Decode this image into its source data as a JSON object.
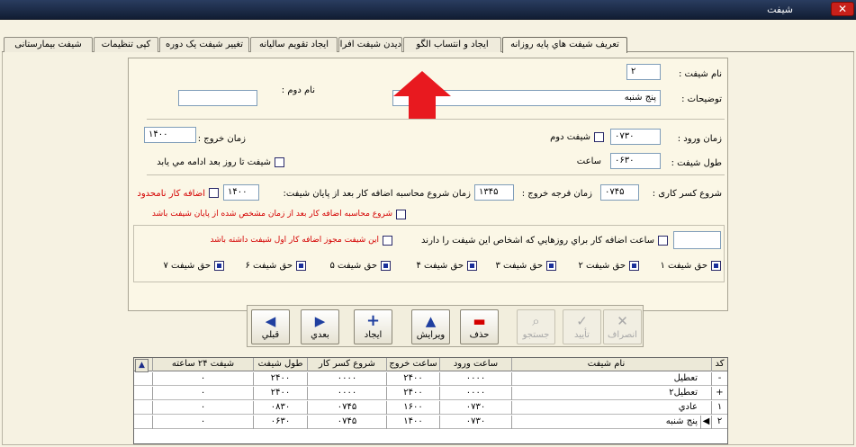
{
  "window": {
    "title": "شيفت",
    "close": "✕"
  },
  "tabs": [
    "تعريف شيفت هاي پايه روزانه",
    "ايجاد و انتساب الگو",
    "ديدن شيفت افراد",
    "ايجاد تقويم ساليانه",
    "تغيير شيفت يک دوره",
    "کپی تنظيمات",
    "شيفت بيمارستانی"
  ],
  "form": {
    "shift_name_label": "نام شيفت :",
    "shift_name": "٢",
    "second_name_label": "نام دوم :",
    "second_name": "",
    "desc_label": "توضيحات :",
    "desc": "پنج شنبه",
    "entry_label": "زمان ورود :",
    "entry": "٠٧٣٠",
    "second_shift_label": "شيفت دوم",
    "exit_label": "زمان خروج :",
    "exit": "١۴٠٠",
    "length_label": "طول شيفت :",
    "length": "٠۶٣٠",
    "hours_label": "ساعت",
    "next_day_label": "شيفت تا روز بعد ادامه مي يابد",
    "deduct_label": "شروع کسر کاری :",
    "deduct": "٠٧۴۵",
    "grace_label": "زمان فرجه خروج :",
    "grace": "١٣۴۵",
    "ot_start_label": "زمان شروع محاسبه اضافه کار بعد از پايان شيفت:",
    "ot_start": "١۴٠٠",
    "unlimited_label": "اضافه کار نامحدود",
    "ot_after_label": "شروع محاسبه اضافه کار بعد از زمان مشخص شده از پايان شيفت باشد",
    "holiday_ot_label": "ساعت اضافه کار براي روزهايي که اشخاص اين شيفت را دارند",
    "holiday_ot": "",
    "first_shift_ot_label": "اين شيفت مجوز اضافه کار اول شيفت داشته باشد",
    "rights": [
      "حق شيفت ١",
      "حق شيفت ٢",
      "حق شيفت ٣",
      "حق شيفت ۴",
      "حق شيفت ۵",
      "حق شيفت ۶",
      "حق شيفت ٧"
    ]
  },
  "toolbar": {
    "cancel": "انصراف",
    "confirm": "تأييد",
    "search": "جستجو",
    "delete": "حذف",
    "edit": "ويرايش",
    "add": "ايجاد",
    "next": "بعدي",
    "prev": "قبلي"
  },
  "grid": {
    "headers": [
      "کد",
      "نام شيفت",
      "ساعت ورود",
      "ساعت خروج",
      "شروع کسر کار",
      "طول شيفت",
      "شيفت ٢۴ ساعته"
    ],
    "rows": [
      [
        "-",
        "تعطيل",
        "٠٠٠٠",
        "٢۴٠٠",
        "٠٠٠٠",
        "٢۴٠٠",
        "٠"
      ],
      [
        "+",
        "تعطيل٢",
        "٠٠٠٠",
        "٢۴٠٠",
        "٠٠٠٠",
        "٢۴٠٠",
        "٠"
      ],
      [
        "١",
        "عادي",
        "٠٧٣٠",
        "١۶٠٠",
        "٠٧۴۵",
        "٠٨٣٠",
        "٠"
      ],
      [
        "٢",
        "پنج شنبه",
        "٠٧٣٠",
        "١۴٠٠",
        "٠٧۴۵",
        "٠۶٣٠",
        "٠"
      ]
    ]
  },
  "colors": {
    "titlebar": "#1c2b48",
    "accent": "#1f3fa0",
    "warning": "#d40000",
    "arrow": "#e8191f"
  }
}
